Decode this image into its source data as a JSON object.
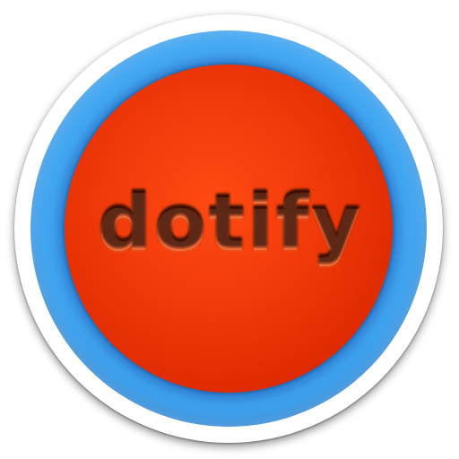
{
  "logo": {
    "text": "dotify"
  },
  "colors": {
    "ring_blue": "#44aaf4",
    "disc_red": "#f13a0a",
    "text_dark_red": "#8a1a00",
    "rim_white": "#ffffff"
  },
  "icon": "app-icon-circle"
}
